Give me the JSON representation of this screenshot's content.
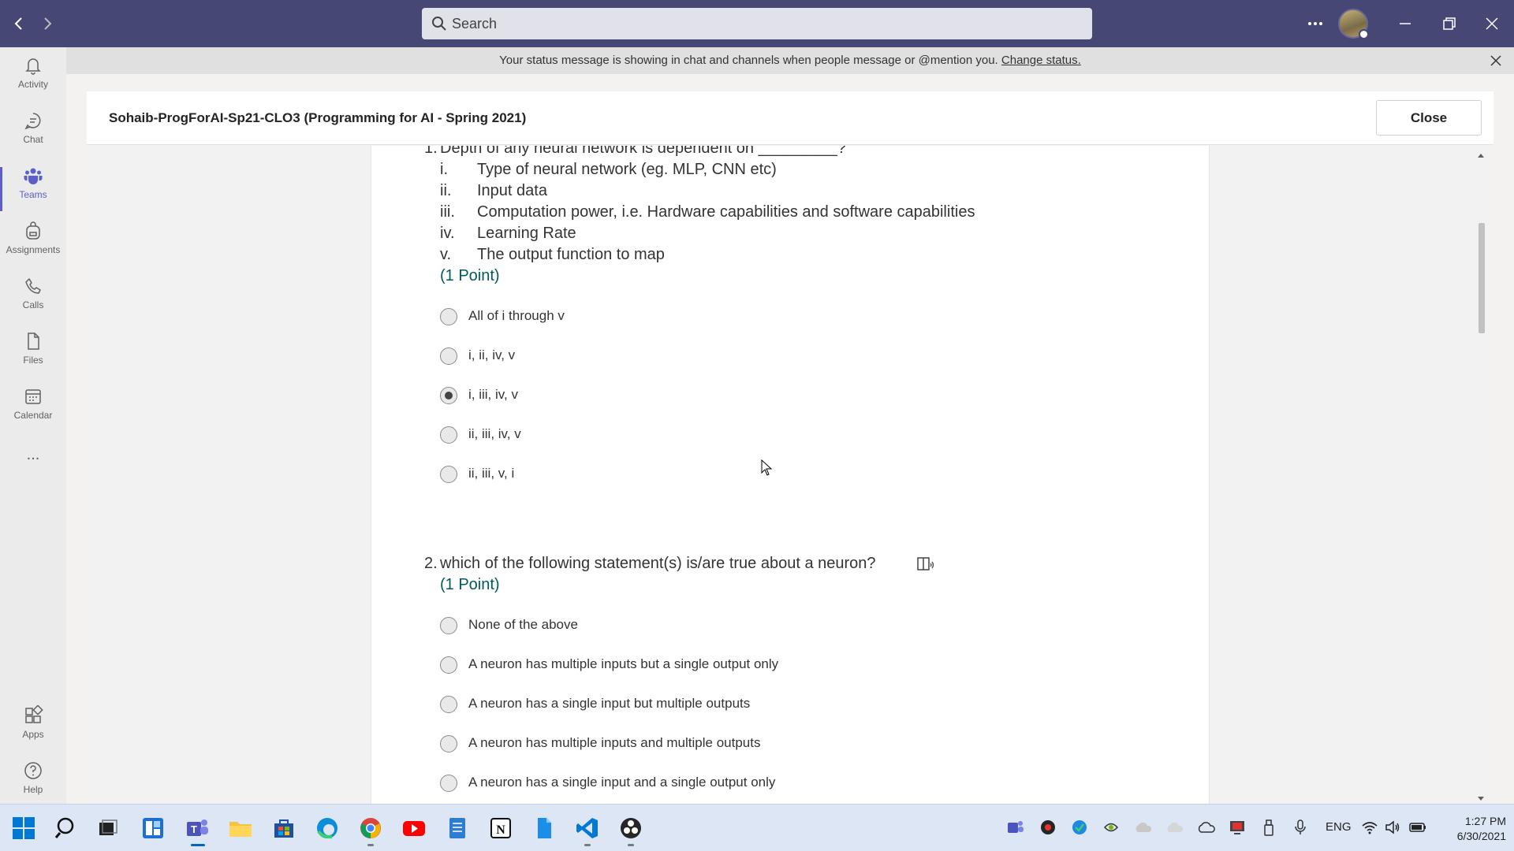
{
  "search": {
    "placeholder": "Search"
  },
  "rail": {
    "items": [
      {
        "label": "Activity",
        "icon": "bell-icon"
      },
      {
        "label": "Chat",
        "icon": "chat-icon"
      },
      {
        "label": "Teams",
        "icon": "teams-icon",
        "active": true
      },
      {
        "label": "Assignments",
        "icon": "backpack-icon"
      },
      {
        "label": "Calls",
        "icon": "phone-icon"
      },
      {
        "label": "Files",
        "icon": "file-icon"
      },
      {
        "label": "Calendar",
        "icon": "calendar-icon"
      }
    ],
    "more": "...",
    "bottom": [
      {
        "label": "Apps",
        "icon": "apps-icon"
      },
      {
        "label": "Help",
        "icon": "help-icon"
      }
    ]
  },
  "banner": {
    "text": "Your status message is showing in chat and channels when people message or @mention you.",
    "link": "Change status."
  },
  "panel": {
    "title": "Sohaib-ProgForAI-Sp21-CLO3 (Programming for AI - Spring 2021)",
    "close_label": "Close"
  },
  "questions": [
    {
      "number": "1.",
      "text": "Depth of any neural network is dependent on _________?",
      "statements": [
        {
          "num": "i.",
          "text": "Type of neural network (eg. MLP, CNN etc)"
        },
        {
          "num": "ii.",
          "text": "Input data"
        },
        {
          "num": "iii.",
          "text": "Computation power, i.e. Hardware capabilities and software capabilities"
        },
        {
          "num": "iv.",
          "text": "Learning Rate"
        },
        {
          "num": "v.",
          "text": "The output function to map"
        }
      ],
      "points": "(1 Point)",
      "options": [
        "All of i through v",
        "i, ii, iv, v",
        "i, iii, iv, v",
        "ii, iii, iv, v",
        "ii, iii, v, i"
      ],
      "selected": 2
    },
    {
      "number": "2.",
      "text": "which of the following statement(s) is/are true about a neuron?",
      "points": "(1 Point)",
      "options": [
        "None of the above",
        "A neuron has multiple inputs but a single output only",
        "A neuron has a single input but multiple outputs",
        "A neuron has multiple inputs and multiple outputs",
        "A neuron has a single input and a single output only"
      ]
    }
  ],
  "taskbar": {
    "apps": [
      "windows-start-icon",
      "search-icon",
      "task-view-icon",
      "widgets-icon",
      "teams-icon",
      "file-explorer-icon",
      "store-icon",
      "edge-icon",
      "chrome-icon",
      "youtube-icon",
      "notepad-icon",
      "notion-icon",
      "files-icon",
      "vscode-icon",
      "obs-icon"
    ],
    "language": "ENG",
    "time": "1:27 PM",
    "date": "6/30/2021"
  },
  "colors": {
    "titlebar": "#464775",
    "accent": "#5b5fc7",
    "points": "#005a5e"
  }
}
